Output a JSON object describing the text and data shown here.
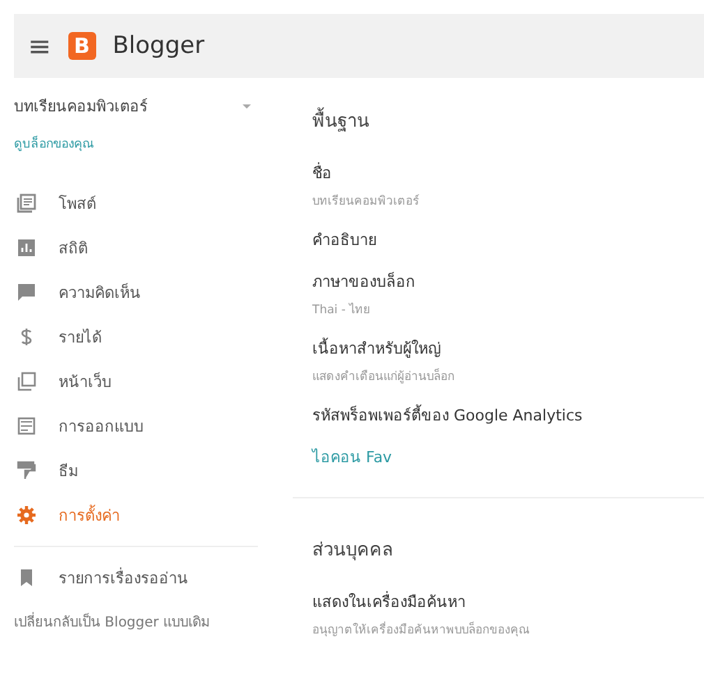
{
  "header": {
    "menu_icon": "≡",
    "logo_letter": "B",
    "title": "Blogger"
  },
  "sidebar": {
    "blog_name": "บทเรียนคอมพิวเตอร์",
    "view_blog_link": "ดูบล็อกของคุณ",
    "items": [
      {
        "label": "โพสต์",
        "selected": false
      },
      {
        "label": "สถิติ",
        "selected": false
      },
      {
        "label": "ความคิดเห็น",
        "selected": false
      },
      {
        "label": "รายได้",
        "selected": false
      },
      {
        "label": "หน้าเว็บ",
        "selected": false
      },
      {
        "label": "การออกแบบ",
        "selected": false
      },
      {
        "label": "ธีม",
        "selected": false
      },
      {
        "label": "การตั้งค่า",
        "selected": true
      }
    ],
    "reading_list": "รายการเรื่องรออ่าน",
    "legacy_link": "เปลี่ยนกลับเป็น Blogger แบบเดิม"
  },
  "sections": [
    {
      "heading": "พื้นฐาน",
      "items": [
        {
          "kind": "setting",
          "label": "ชื่อ",
          "value": "บทเรียนคอมพิวเตอร์"
        },
        {
          "kind": "setting",
          "label": "คำอธิบาย"
        },
        {
          "kind": "setting",
          "label": "ภาษาของบล็อก",
          "value": "Thai - ไทย"
        },
        {
          "kind": "setting",
          "label": "เนื้อหาสำหรับผู้ใหญ่",
          "value": "แสดงคำเตือนแก่ผู้อ่านบล็อก"
        },
        {
          "kind": "setting",
          "label": "รหัสพร็อพเพอร์ตี้ของ Google Analytics"
        },
        {
          "kind": "link",
          "label": "ไอคอน Fav"
        }
      ]
    },
    {
      "heading": "ส่วนบุคคล",
      "items": [
        {
          "kind": "setting",
          "label": "แสดงในเครื่องมือค้นหา",
          "value": "อนุญาตให้เครื่องมือค้นหาพบบล็อกของคุณ"
        }
      ]
    }
  ]
}
